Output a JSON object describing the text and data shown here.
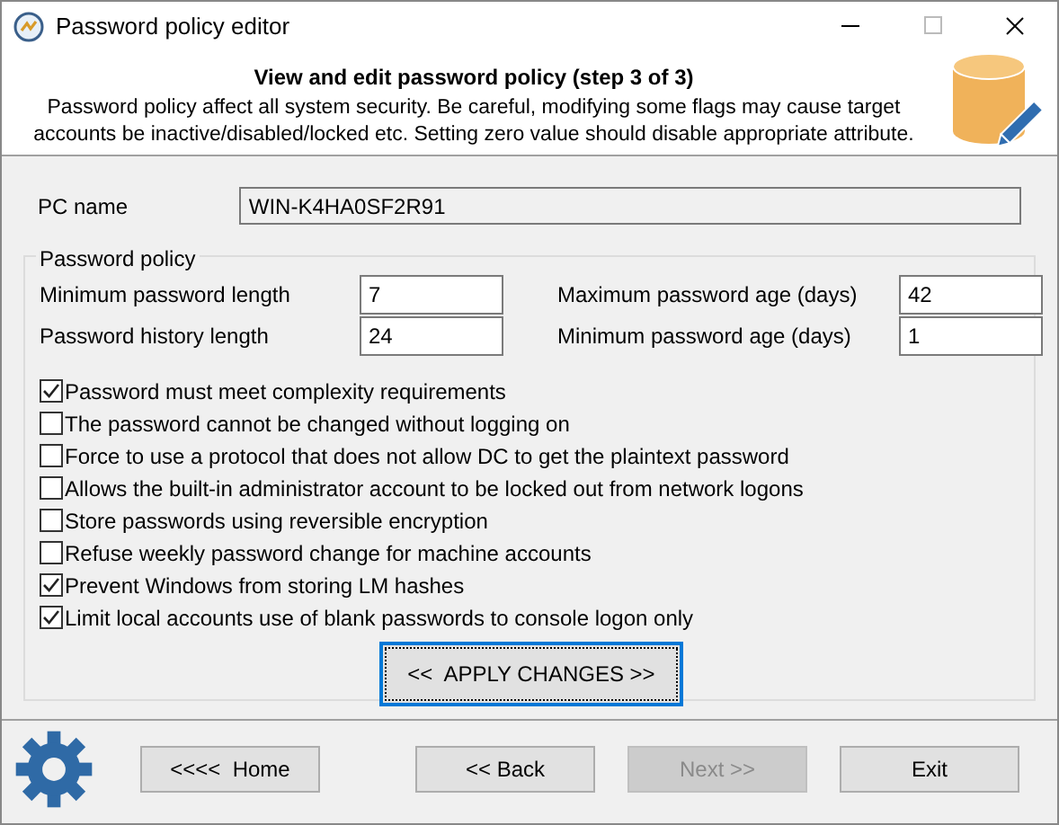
{
  "window": {
    "title": "Password policy editor"
  },
  "header": {
    "title": "View and edit password policy (step 3 of 3)",
    "description": "Password policy affect all system security. Be careful, modifying some flags may cause target accounts be inactive/disabled/locked etc. Setting zero value should disable appropriate attribute."
  },
  "pc_name": {
    "label": "PC name",
    "value": "WIN-K4HA0SF2R91"
  },
  "policy": {
    "title": "Password policy",
    "fields": [
      {
        "label": "Minimum password length",
        "value": "7"
      },
      {
        "label": "Maximum password age (days)",
        "value": "42"
      },
      {
        "label": "Password history length",
        "value": "24"
      },
      {
        "label": "Minimum password age (days)",
        "value": "1"
      }
    ],
    "options": [
      {
        "label": "Password must meet complexity requirements",
        "checked": true
      },
      {
        "label": "The password cannot be changed without logging on",
        "checked": false
      },
      {
        "label": "Force to use a protocol that does not allow DC to get the plaintext password",
        "checked": false
      },
      {
        "label": "Allows the built-in administrator account to be locked out from network logons",
        "checked": false
      },
      {
        "label": "Store passwords using reversible encryption",
        "checked": false
      },
      {
        "label": "Refuse weekly password change for machine accounts",
        "checked": false
      },
      {
        "label": "Prevent Windows from storing LM hashes",
        "checked": true
      },
      {
        "label": "Limit local accounts use of blank passwords to console logon only",
        "checked": true
      }
    ],
    "apply_button": {
      "label": "<<  APPLY CHANGES >>",
      "focused": true
    }
  },
  "buttons": [
    {
      "label": "<<<<  Home",
      "disabled": false
    },
    {
      "label": "<< Back",
      "disabled": false
    },
    {
      "label": "Next >>",
      "disabled": true
    },
    {
      "label": "Exit",
      "disabled": false
    }
  ]
}
